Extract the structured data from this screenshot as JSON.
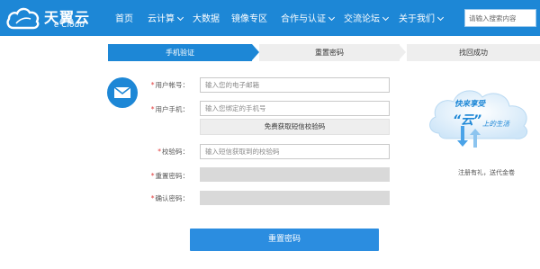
{
  "header": {
    "logo": {
      "name_cn": "天翼云",
      "name_en": "e Cloud"
    },
    "nav": [
      {
        "label": "首页",
        "has_dropdown": false
      },
      {
        "label": "云计算",
        "has_dropdown": true
      },
      {
        "label": "大数据",
        "has_dropdown": false
      },
      {
        "label": "镜像专区",
        "has_dropdown": false
      },
      {
        "label": "合作与认证",
        "has_dropdown": true
      },
      {
        "label": "交流论坛",
        "has_dropdown": true
      },
      {
        "label": "关于我们",
        "has_dropdown": true
      }
    ],
    "search": {
      "placeholder": "请输入搜索内容"
    }
  },
  "steps": [
    {
      "label": "手机验证",
      "active": true
    },
    {
      "label": "重置密码",
      "active": false
    },
    {
      "label": "找回成功",
      "active": false
    }
  ],
  "form": {
    "account": {
      "label": "用户帐号：",
      "placeholder": "输入您的电子邮箱",
      "required": "*"
    },
    "phone": {
      "label": "用户手机：",
      "placeholder": "输入您绑定的手机号",
      "required": "*"
    },
    "sms_button": "免费获取短信校验码",
    "code": {
      "label": "校验码：",
      "placeholder": "输入短信获取到的校验码",
      "required": "*"
    },
    "new_password": {
      "label": "重置密码：",
      "required": "*"
    },
    "confirm_password": {
      "label": "确认密码：",
      "required": "*"
    },
    "submit": "重置密码"
  },
  "promo": {
    "line1": "快来享受",
    "cloud_char": "“云”",
    "line2": "上的生活",
    "caption": "注册有礼，送代金卷"
  },
  "colors": {
    "brand_blue": "#1d87d6",
    "button_blue": "#2b8de0",
    "step_inactive": "#eeeeee",
    "required_red": "#e23b3b"
  }
}
